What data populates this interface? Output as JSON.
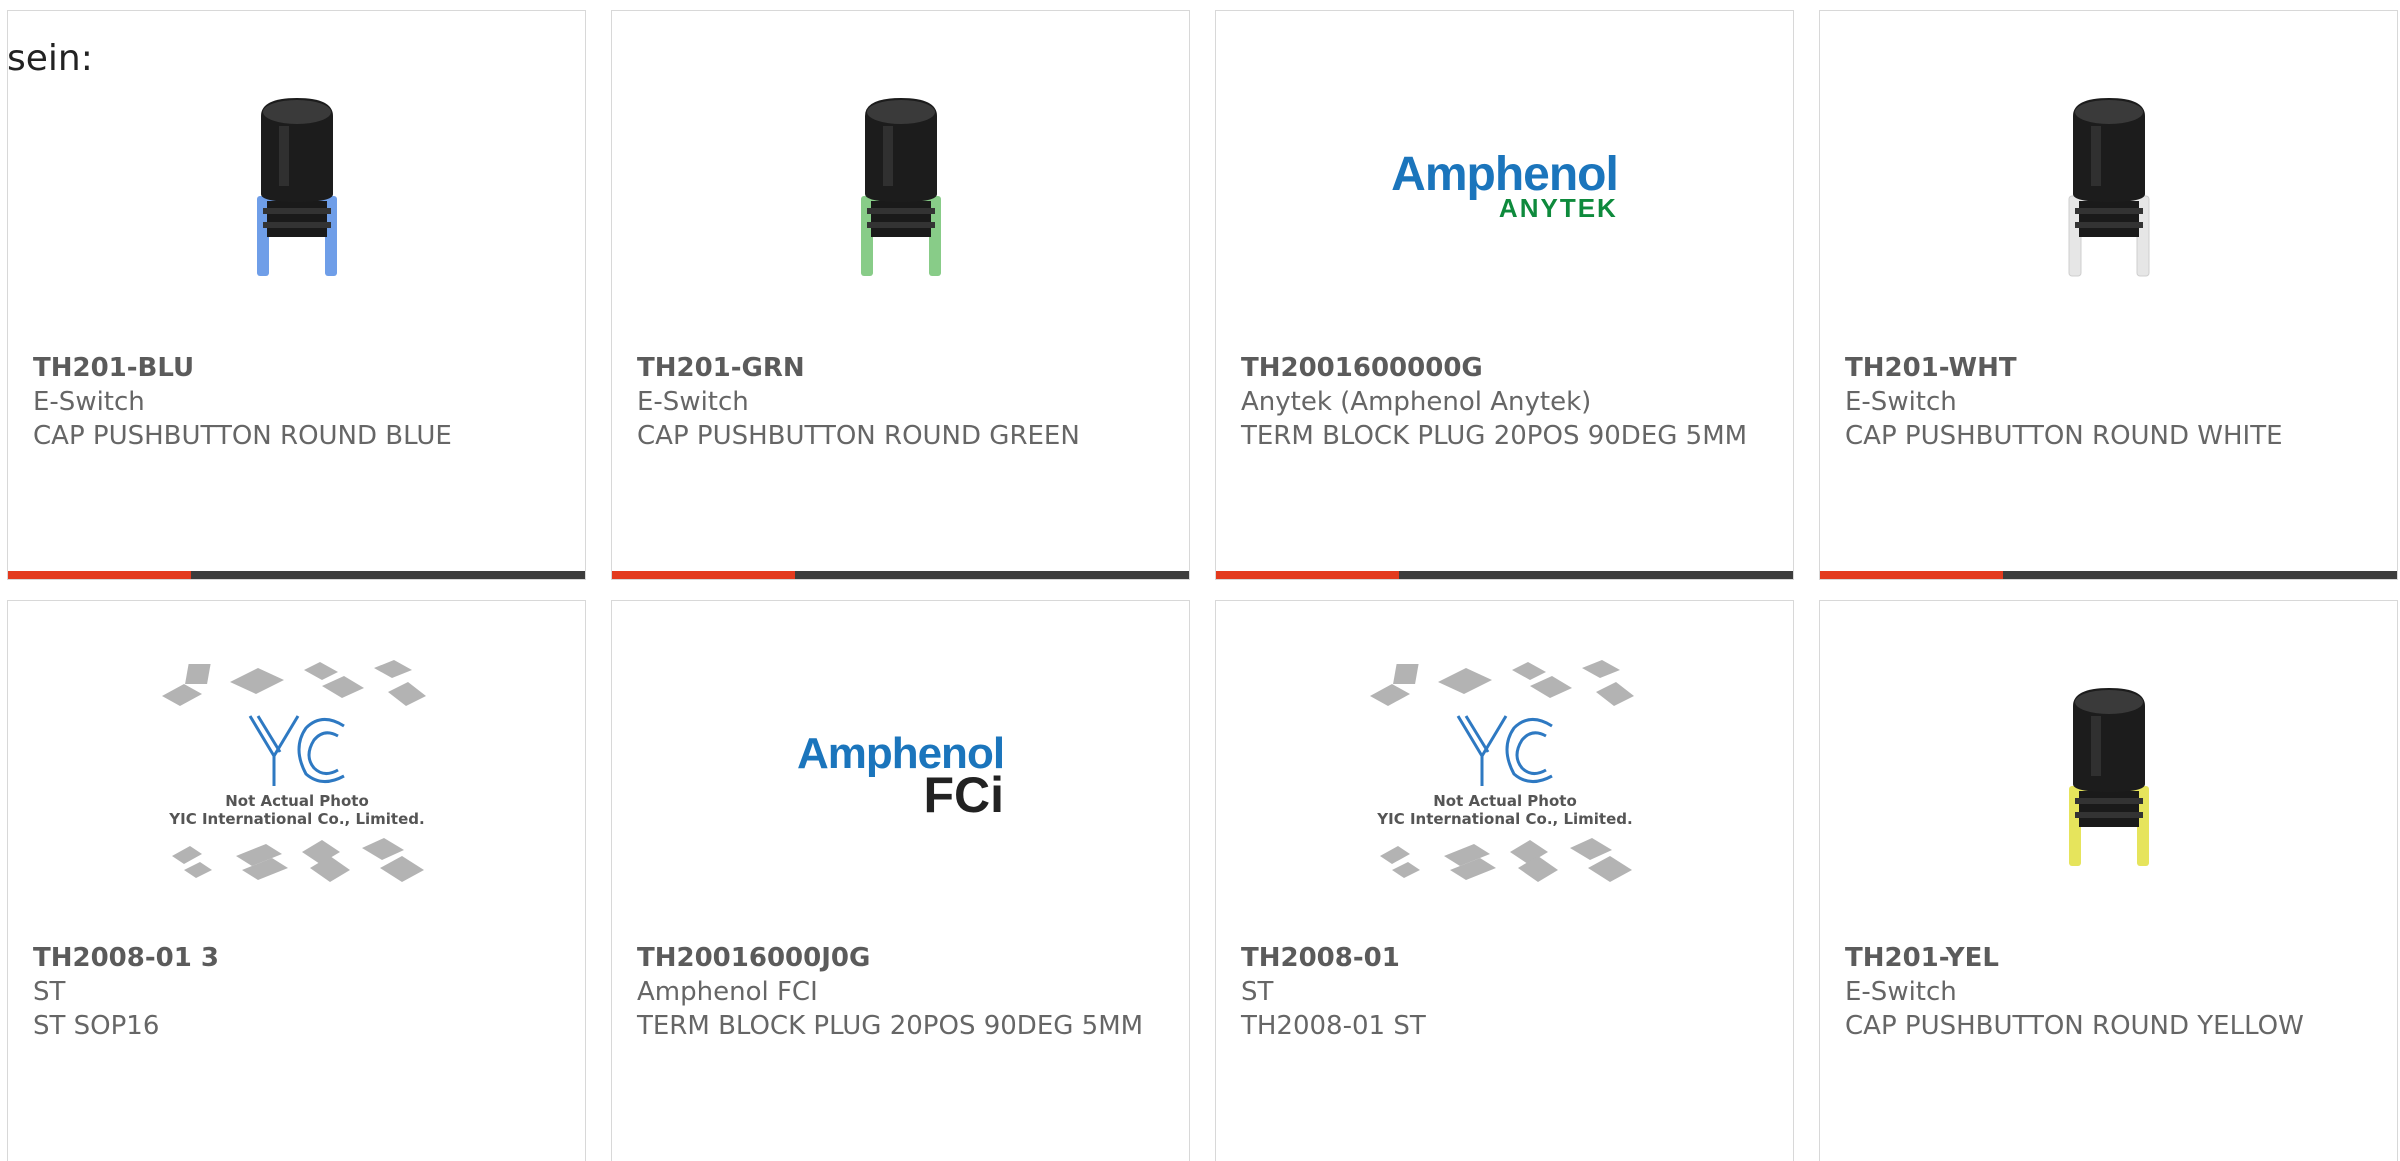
{
  "intro_text": "sein:",
  "products": [
    {
      "part_number": "TH201-BLU",
      "manufacturer": "E-Switch",
      "description": "CAP PUSHBUTTON ROUND BLUE",
      "image": "blue-pushbutton-cap",
      "image_color": "#6f9ee8"
    },
    {
      "part_number": "TH201-GRN",
      "manufacturer": "E-Switch",
      "description": "CAP PUSHBUTTON ROUND GREEN",
      "image": "green-pushbutton-cap",
      "image_color": "#88cc88"
    },
    {
      "part_number": "TH2001600000G",
      "manufacturer": "Anytek (Amphenol Anytek)",
      "description": "TERM BLOCK PLUG 20POS 90DEG 5MM",
      "image": "amphenol-anytek-logo",
      "logo_line1": "Amphenol",
      "logo_line2": "ANYTEK"
    },
    {
      "part_number": "TH201-WHT",
      "manufacturer": "E-Switch",
      "description": "CAP PUSHBUTTON ROUND WHITE",
      "image": "white-pushbutton-cap",
      "image_color": "#e6e6e6"
    },
    {
      "part_number": "TH2008-01 3",
      "manufacturer": "ST",
      "description": "ST SOP16",
      "image": "yic-placeholder",
      "placeholder_line1": "Not Actual Photo",
      "placeholder_line2": "YIC International Co., Limited."
    },
    {
      "part_number": "TH20016000J0G",
      "manufacturer": "Amphenol FCI",
      "description": "TERM BLOCK PLUG 20POS 90DEG 5MM",
      "image": "amphenol-fci-logo",
      "logo_line1": "Amphenol",
      "logo_line2": "FCi"
    },
    {
      "part_number": "TH2008-01",
      "manufacturer": "ST",
      "description": "TH2008-01 ST",
      "image": "yic-placeholder",
      "placeholder_line1": "Not Actual Photo",
      "placeholder_line2": "YIC International Co., Limited."
    },
    {
      "part_number": "TH201-YEL",
      "manufacturer": "E-Switch",
      "description": "CAP PUSHBUTTON ROUND YELLOW",
      "image": "yellow-pushbutton-cap",
      "image_color": "#e6e45c"
    }
  ],
  "colors": {
    "accent": "#e33a1e",
    "bar": "#3c3c3c",
    "border": "#d8d8d8",
    "text": "#666666"
  }
}
